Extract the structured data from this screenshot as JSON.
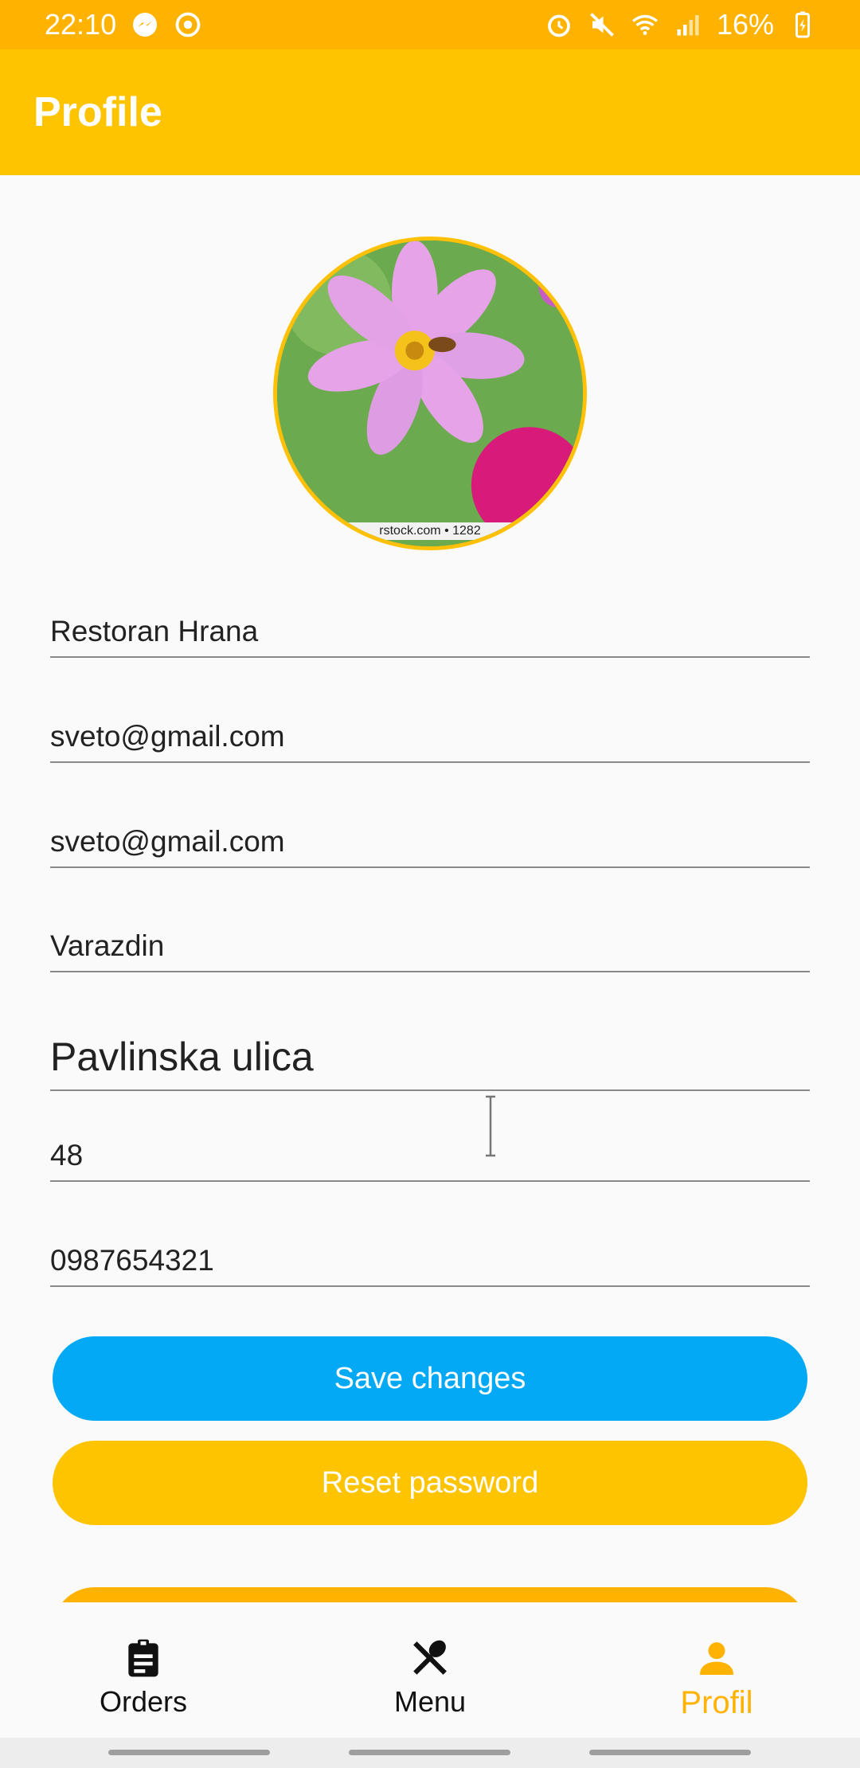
{
  "status_bar": {
    "time": "22:10",
    "battery_text": "16%"
  },
  "app_bar": {
    "title": "Profile"
  },
  "avatar": {
    "caption": "rstock.com • 1282"
  },
  "form": {
    "name": "Restoran Hrana",
    "email": "sveto@gmail.com",
    "email_confirm": "sveto@gmail.com",
    "city": "Varazdin",
    "street": "Pavlinska ulica",
    "house_number": "48",
    "phone": "0987654321"
  },
  "buttons": {
    "save": "Save changes",
    "reset": "Reset password"
  },
  "bottom_nav": {
    "items": [
      {
        "label": "Orders",
        "icon": "clipboard-icon"
      },
      {
        "label": "Menu",
        "icon": "utensils-icon"
      },
      {
        "label": "Profil",
        "icon": "person-icon"
      }
    ],
    "active": "Profil"
  },
  "colors": {
    "status_bar": "#FFB300",
    "app_bar": "#FFC400",
    "save_button": "#03A9F4",
    "reset_button": "#FFC400",
    "active_nav": "#FFB300"
  }
}
